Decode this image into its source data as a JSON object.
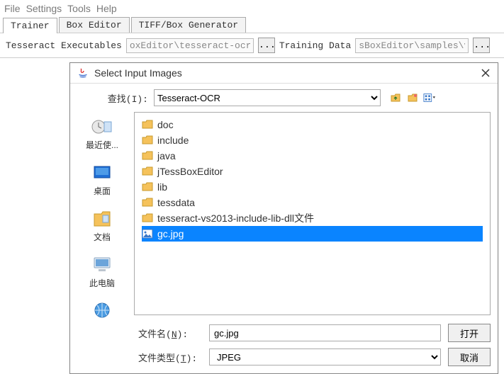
{
  "menu": {
    "file": "File",
    "settings": "Settings",
    "tools": "Tools",
    "help": "Help"
  },
  "tabs": {
    "trainer": "Trainer",
    "box_editor": "Box Editor",
    "tiff_box": "TIFF/Box Generator"
  },
  "pathbar": {
    "exec_label": "Tesseract Executables",
    "exec_value": "oxEditor\\tesseract-ocr",
    "train_label": "Training Data",
    "train_value": "sBoxEditor\\samples\\vie",
    "dots": "..."
  },
  "dialog": {
    "title": "Select Input Images",
    "lookin_label": "查找(I):",
    "lookin_value": "Tesseract-OCR",
    "sidebar": {
      "recent": "最近使...",
      "desktop": "桌面",
      "documents": "文档",
      "thispc": "此电脑",
      "network": "网络"
    },
    "files": [
      {
        "name": "doc",
        "type": "folder"
      },
      {
        "name": "include",
        "type": "folder"
      },
      {
        "name": "java",
        "type": "folder"
      },
      {
        "name": "jTessBoxEditor",
        "type": "folder"
      },
      {
        "name": "lib",
        "type": "folder"
      },
      {
        "name": "tessdata",
        "type": "folder"
      },
      {
        "name": "tesseract-vs2013-include-lib-dll文件",
        "type": "folder"
      },
      {
        "name": "gc.jpg",
        "type": "image",
        "selected": true
      }
    ],
    "filename_label_pre": "文件名(",
    "filename_label_u": "N",
    "filename_label_post": "):",
    "filename_value": "gc.jpg",
    "filetype_label_pre": "文件类型(",
    "filetype_label_u": "T",
    "filetype_label_post": "):",
    "filetype_value": "JPEG",
    "open_btn": "打开",
    "cancel_btn": "取消"
  }
}
